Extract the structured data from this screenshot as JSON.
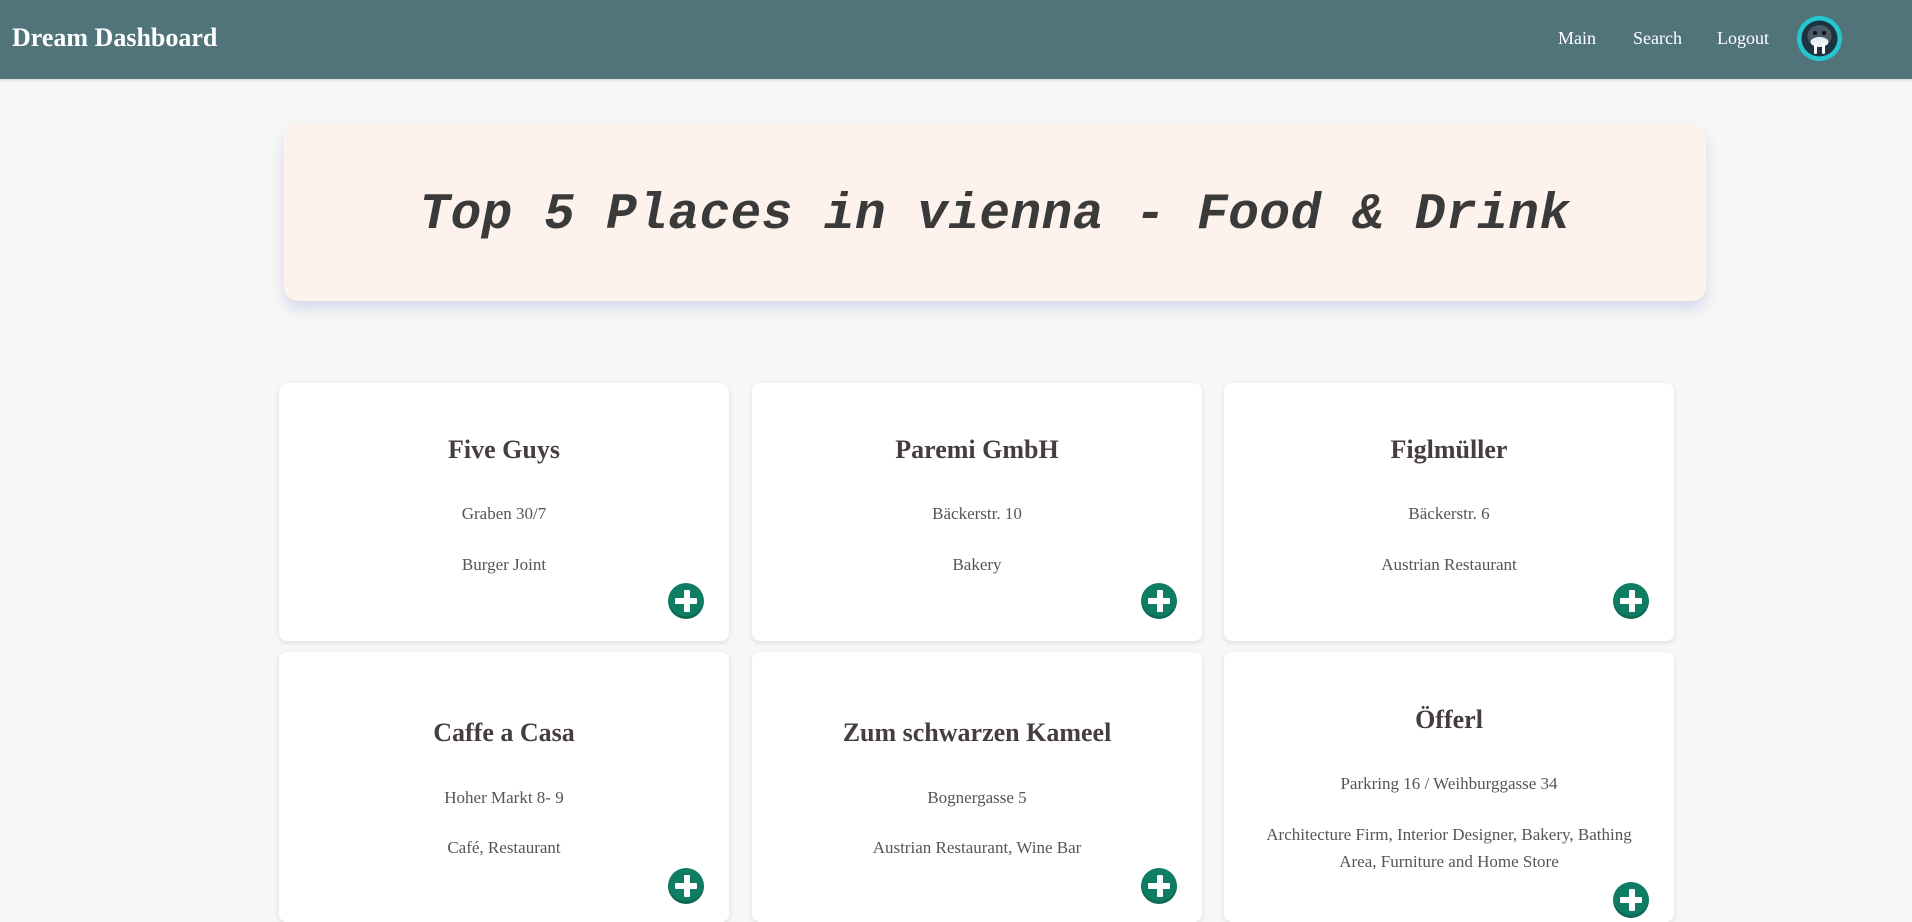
{
  "header": {
    "brand": "Dream Dashboard",
    "nav": {
      "main": "Main",
      "search": "Search",
      "logout": "Logout"
    },
    "avatar_icon": "walrus-avatar-icon"
  },
  "title": "Top 5 Places in vienna - Food & Drink",
  "colors": {
    "navbar": "#51747b",
    "title_card": "#fdf3ec",
    "add_button": "#0f7d63",
    "avatar_ring": "#26c6cf"
  },
  "places": [
    {
      "name": "Five Guys",
      "address": "Graben 30/7",
      "category": "Burger Joint",
      "action_icon": "plus-circle-icon"
    },
    {
      "name": "Paremi GmbH",
      "address": "Bäckerstr. 10",
      "category": "Bakery",
      "action_icon": "plus-circle-icon"
    },
    {
      "name": "Figlmüller",
      "address": "Bäckerstr. 6",
      "category": "Austrian Restaurant",
      "action_icon": "plus-circle-icon"
    },
    {
      "name": "Caffe a Casa",
      "address": "Hoher Markt 8- 9",
      "category": "Café, Restaurant",
      "action_icon": "plus-circle-icon"
    },
    {
      "name": "Zum schwarzen Kameel",
      "address": "Bognergasse 5",
      "category": "Austrian Restaurant, Wine Bar",
      "action_icon": "plus-circle-icon"
    },
    {
      "name": "Öfferl",
      "address": "Parkring 16 / Weihburggasse 34",
      "category": "Architecture Firm, Interior Designer, Bakery, Bathing Area, Furniture and Home Store",
      "action_icon": "plus-circle-icon"
    }
  ]
}
